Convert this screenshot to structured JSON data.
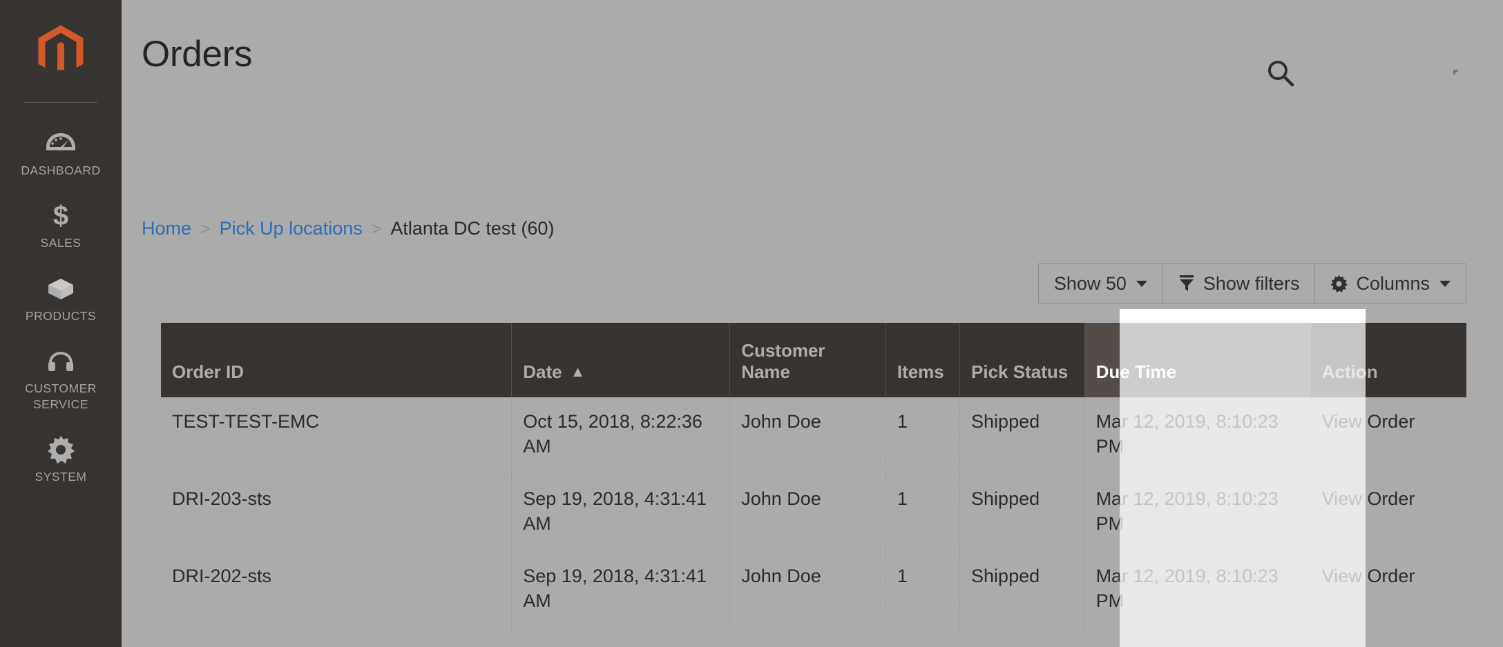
{
  "sidebar": {
    "logo": {
      "name": "magento-logo",
      "color": "#d3582a"
    },
    "items": [
      {
        "label": "Dashboard",
        "icon": "dashboard-gauge-icon"
      },
      {
        "label": "Sales",
        "icon": "dollar-sign-icon"
      },
      {
        "label": "Products",
        "icon": "box-icon"
      },
      {
        "label": "Customer Service",
        "icon": "headset-icon"
      },
      {
        "label": "System",
        "icon": "gear-icon"
      }
    ]
  },
  "header": {
    "title": "Orders",
    "search_icon": "search-icon"
  },
  "breadcrumb": {
    "items": [
      {
        "label": "Home",
        "link": true
      },
      {
        "label": "Pick Up locations",
        "link": true
      },
      {
        "label": "Atlanta DC test (60)",
        "link": false
      }
    ],
    "separator": ">"
  },
  "toolbar": {
    "show_label": "Show 50",
    "filters_label": "Show filters",
    "filters_icon": "funnel-icon",
    "columns_label": "Columns",
    "columns_icon": "gear-icon"
  },
  "grid": {
    "columns": [
      {
        "key": "order_id",
        "label": "Order ID",
        "sorted": false,
        "highlighted": false
      },
      {
        "key": "date",
        "label": "Date",
        "sorted": true,
        "sort_dir": "asc",
        "highlighted": false
      },
      {
        "key": "customer_name",
        "label": "Customer Name",
        "sorted": false,
        "highlighted": false
      },
      {
        "key": "items",
        "label": "Items",
        "sorted": false,
        "highlighted": false
      },
      {
        "key": "pick_status",
        "label": "Pick Status",
        "sorted": false,
        "highlighted": false
      },
      {
        "key": "due_time",
        "label": "Due Time",
        "sorted": false,
        "highlighted": true
      },
      {
        "key": "action",
        "label": "Action",
        "sorted": false,
        "highlighted": false
      }
    ],
    "rows": [
      {
        "order_id": "TEST-TEST-EMC",
        "date": "Oct 15, 2018, 8:22:36 AM",
        "customer_name": "John Doe",
        "items": "1",
        "pick_status": "Shipped",
        "due_time": "Mar 12, 2019, 8:10:23 PM",
        "action": "View Order"
      },
      {
        "order_id": "DRI-203-sts",
        "date": "Sep 19, 2018, 4:31:41 AM",
        "customer_name": "John Doe",
        "items": "1",
        "pick_status": "Shipped",
        "due_time": "Mar 12, 2019, 8:10:23 PM",
        "action": "View Order"
      },
      {
        "order_id": "DRI-202-sts",
        "date": "Sep 19, 2018, 4:31:41 AM",
        "customer_name": "John Doe",
        "items": "1",
        "pick_status": "Shipped",
        "due_time": "Mar 12, 2019, 8:10:23 PM",
        "action": "View Order"
      }
    ]
  },
  "colors": {
    "sidebar_bg": "#373330",
    "page_bg": "#ababab",
    "header_row_bg": "#373330",
    "highlight_header_bg": "#544c46",
    "link": "#2a6fb8",
    "brand_orange": "#d3582a"
  }
}
